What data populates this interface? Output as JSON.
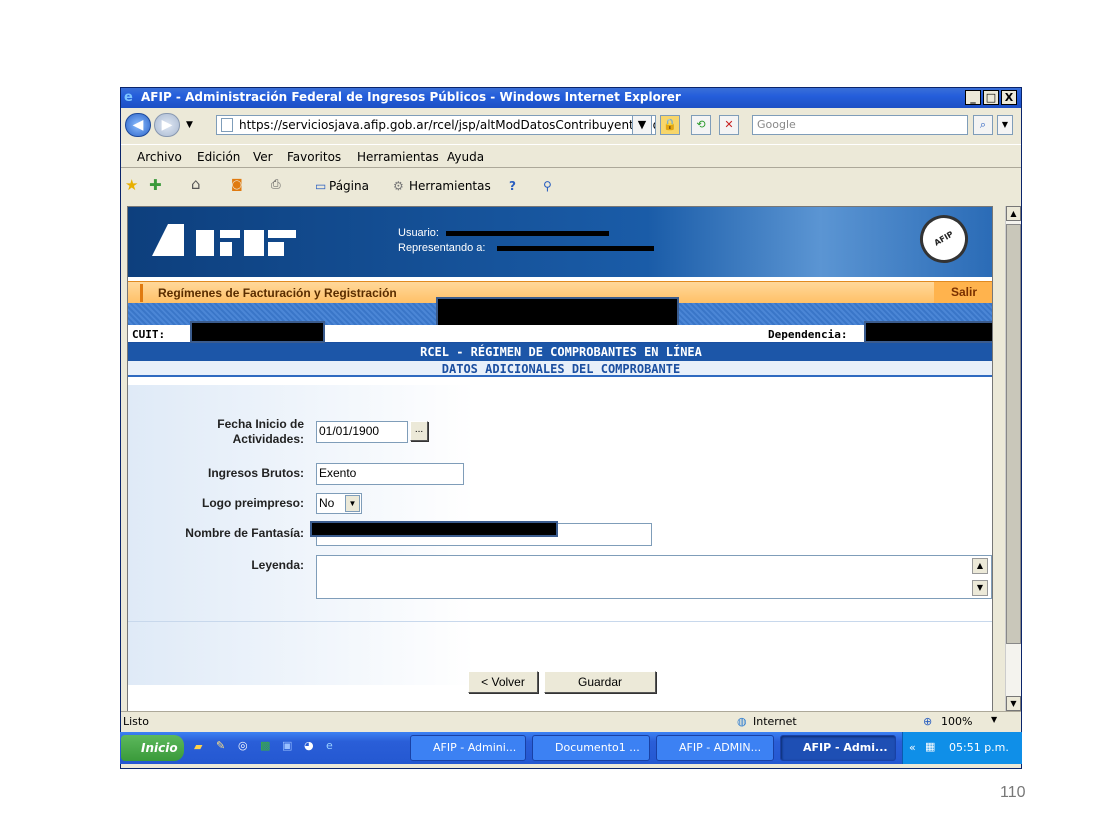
{
  "window": {
    "title": "AFIP - Administración Federal de Ingresos Públicos - Windows Internet Explorer",
    "min": "_",
    "max": "□",
    "close": "X"
  },
  "address": {
    "url": "https://serviciosjava.afip.gob.ar/rcel/jsp/altModDatosContribuyente.do",
    "search_placeholder": "Google"
  },
  "menu": [
    "Archivo",
    "Edición",
    "Ver",
    "Favoritos",
    "Herramientas",
    "Ayuda"
  ],
  "favbar": {
    "pagina": "Página",
    "herramientas": "Herramientas"
  },
  "header": {
    "usuario_label": "Usuario:",
    "representando_label": "Representando a:",
    "section_title": "Regímenes de Facturación y Registración",
    "salir": "Salir",
    "cuit_label": "CUIT:",
    "dependencia_label": "Dependencia:",
    "rcel_title": "RCEL - RÉGIMEN DE COMPROBANTES EN LÍNEA",
    "subtitle": "DATOS ADICIONALES DEL COMPROBANTE"
  },
  "form": {
    "fecha_label_1": "Fecha Inicio de",
    "fecha_label_2": "Actividades:",
    "fecha_value": "01/01/1900",
    "fecha_btn": "...",
    "ingresos_label": "Ingresos Brutos:",
    "ingresos_value": "Exento",
    "logo_label": "Logo preimpreso:",
    "logo_value": "No",
    "fantasia_label": "Nombre de Fantasía:",
    "leyenda_label": "Leyenda:",
    "leyenda_value": "",
    "volver": "< Volver",
    "guardar": "Guardar"
  },
  "status": {
    "left": "Listo",
    "zone": "Internet",
    "zoom": "100%"
  },
  "taskbar": {
    "start": "Inicio",
    "tasks": [
      "AFIP - Admini...",
      "Documento1 ...",
      "AFIP - ADMIN...",
      "AFIP - Admi..."
    ],
    "clock": "05:51 p.m."
  },
  "slide_number": "110",
  "colors": {
    "titlebar": "#245edb",
    "header_blue": "#1a5ca8",
    "orange": "#ffc067",
    "rcel_bar": "#1c56a8"
  }
}
